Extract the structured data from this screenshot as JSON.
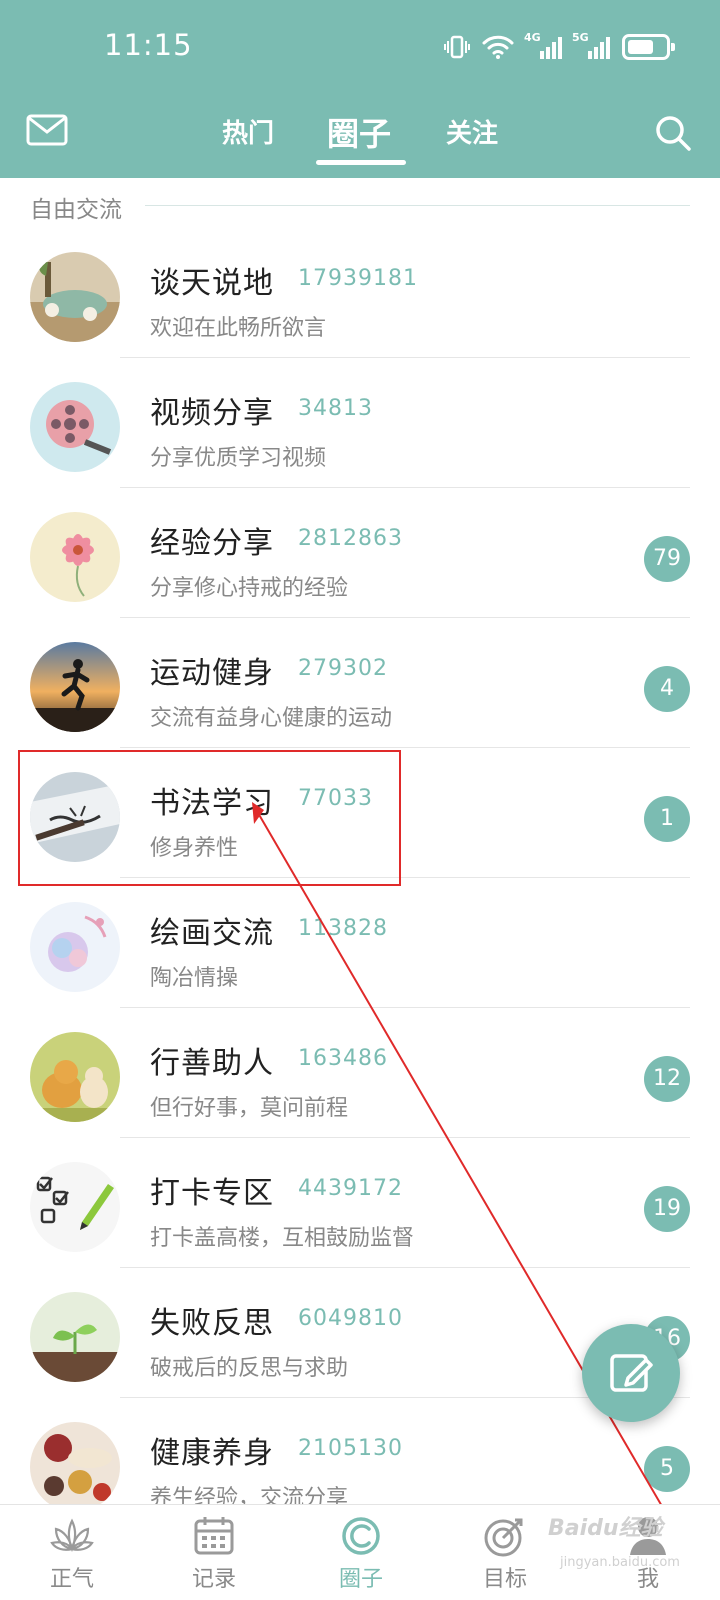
{
  "status_bar": {
    "time": "11:15",
    "net1": "4G",
    "net2": "5G"
  },
  "header": {
    "tabs": [
      {
        "label": "热门"
      },
      {
        "label": "圈子"
      },
      {
        "label": "关注"
      }
    ],
    "accent_color": "#7bbcb2"
  },
  "section": {
    "label": "自由交流"
  },
  "circles": [
    {
      "name": "谈天说地",
      "members": "17939181",
      "desc": "欢迎在此畅所欲言",
      "badge": ""
    },
    {
      "name": "视频分享",
      "members": "34813",
      "desc": "分享优质学习视频",
      "badge": ""
    },
    {
      "name": "经验分享",
      "members": "2812863",
      "desc": "分享修心持戒的经验",
      "badge": "79"
    },
    {
      "name": "运动健身",
      "members": "279302",
      "desc": "交流有益身心健康的运动",
      "badge": "4"
    },
    {
      "name": "书法学习",
      "members": "77033",
      "desc": "修身养性",
      "badge": "1"
    },
    {
      "name": "绘画交流",
      "members": "113828",
      "desc": "陶冶情操",
      "badge": ""
    },
    {
      "name": "行善助人",
      "members": "163486",
      "desc": "但行好事，莫问前程",
      "badge": "12"
    },
    {
      "name": "打卡专区",
      "members": "4439172",
      "desc": "打卡盖高楼，互相鼓励监督",
      "badge": "19"
    },
    {
      "name": "失败反思",
      "members": "6049810",
      "desc": "破戒后的反思与求助",
      "badge": "16"
    },
    {
      "name": "健康养身",
      "members": "2105130",
      "desc": "养生经验，交流分享",
      "badge": "5"
    }
  ],
  "bottom_nav": [
    {
      "label": "正气"
    },
    {
      "label": "记录"
    },
    {
      "label": "圈子"
    },
    {
      "label": "目标"
    },
    {
      "label": "我"
    }
  ],
  "watermark": {
    "brand": "Baidu经验",
    "url": "jingyan.baidu.com"
  }
}
